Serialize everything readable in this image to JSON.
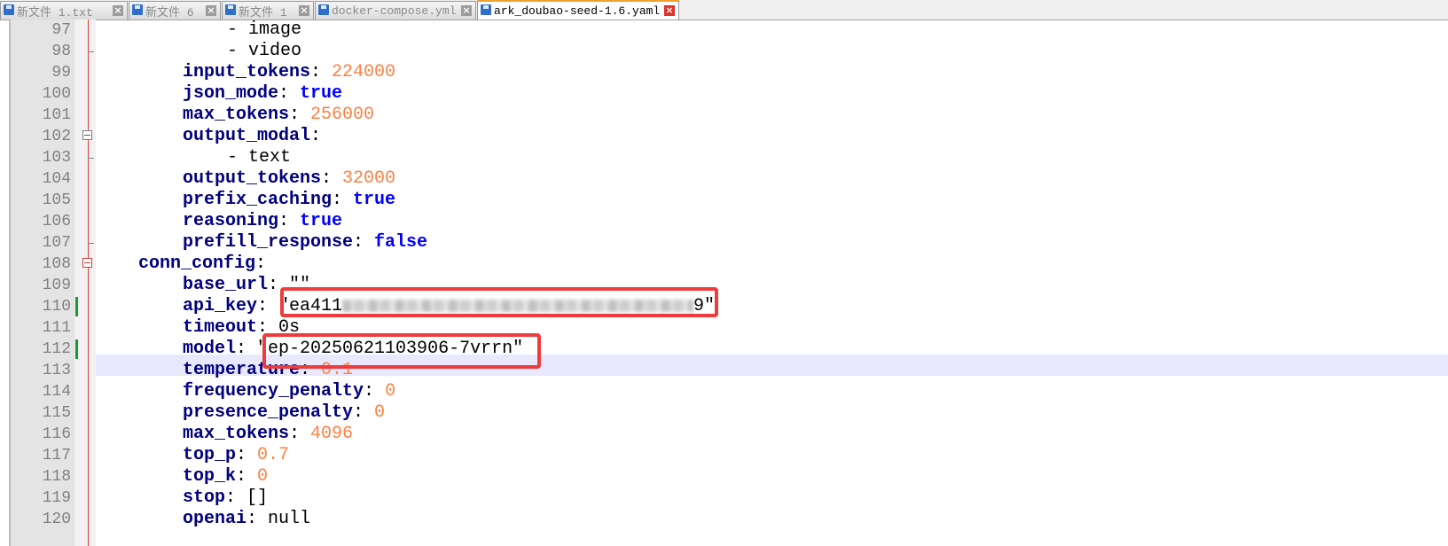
{
  "tabs": [
    {
      "label": "新文件 1.txt",
      "active": false
    },
    {
      "label": "新文件 6",
      "active": false
    },
    {
      "label": "新文件 1",
      "active": false
    },
    {
      "label": "docker-compose.yml",
      "active": false
    },
    {
      "label": "ark_doubao-seed-1.6.yaml",
      "active": true
    }
  ],
  "lines": [
    {
      "num": "97",
      "indent": "        ",
      "prefix": "- ",
      "key": "",
      "sep": "",
      "value": "image",
      "vtype": "plain"
    },
    {
      "num": "98",
      "indent": "        ",
      "prefix": "- ",
      "key": "",
      "sep": "",
      "value": "video",
      "vtype": "plain"
    },
    {
      "num": "99",
      "indent": "    ",
      "prefix": "",
      "key": "input_tokens",
      "sep": ": ",
      "value": "224000",
      "vtype": "num"
    },
    {
      "num": "100",
      "indent": "    ",
      "prefix": "",
      "key": "json_mode",
      "sep": ": ",
      "value": "true",
      "vtype": "bool"
    },
    {
      "num": "101",
      "indent": "    ",
      "prefix": "",
      "key": "max_tokens",
      "sep": ": ",
      "value": "256000",
      "vtype": "num"
    },
    {
      "num": "102",
      "indent": "    ",
      "prefix": "",
      "key": "output_modal",
      "sep": ":",
      "value": "",
      "vtype": "plain"
    },
    {
      "num": "103",
      "indent": "        ",
      "prefix": "- ",
      "key": "",
      "sep": "",
      "value": "text",
      "vtype": "plain"
    },
    {
      "num": "104",
      "indent": "    ",
      "prefix": "",
      "key": "output_tokens",
      "sep": ": ",
      "value": "32000",
      "vtype": "num"
    },
    {
      "num": "105",
      "indent": "    ",
      "prefix": "",
      "key": "prefix_caching",
      "sep": ": ",
      "value": "true",
      "vtype": "bool"
    },
    {
      "num": "106",
      "indent": "    ",
      "prefix": "",
      "key": "reasoning",
      "sep": ": ",
      "value": "true",
      "vtype": "bool"
    },
    {
      "num": "107",
      "indent": "    ",
      "prefix": "",
      "key": "prefill_response",
      "sep": ": ",
      "value": "false",
      "vtype": "bool"
    },
    {
      "num": "108",
      "indent": "",
      "prefix": "",
      "key": "conn_config",
      "sep": ":",
      "value": "",
      "vtype": "plain"
    },
    {
      "num": "109",
      "indent": "    ",
      "prefix": "",
      "key": "base_url",
      "sep": ": ",
      "value": "\"\"",
      "vtype": "str"
    },
    {
      "num": "110",
      "indent": "    ",
      "prefix": "",
      "key": "api_key",
      "sep": ": ",
      "value": "\"ea411",
      "value_tail": "9\"",
      "vtype": "secret"
    },
    {
      "num": "111",
      "indent": "    ",
      "prefix": "",
      "key": "timeout",
      "sep": ": ",
      "value": "0s",
      "vtype": "plain"
    },
    {
      "num": "112",
      "indent": "    ",
      "prefix": "",
      "key": "model",
      "sep": ": ",
      "value": "\"ep-20250621103906-7vrrn\"",
      "vtype": "str"
    },
    {
      "num": "113",
      "indent": "    ",
      "prefix": "",
      "key": "temperature",
      "sep": ": ",
      "value": "0.1",
      "vtype": "num"
    },
    {
      "num": "114",
      "indent": "    ",
      "prefix": "",
      "key": "frequency_penalty",
      "sep": ": ",
      "value": "0",
      "vtype": "num"
    },
    {
      "num": "115",
      "indent": "    ",
      "prefix": "",
      "key": "presence_penalty",
      "sep": ": ",
      "value": "0",
      "vtype": "num"
    },
    {
      "num": "116",
      "indent": "    ",
      "prefix": "",
      "key": "max_tokens",
      "sep": ": ",
      "value": "4096",
      "vtype": "num"
    },
    {
      "num": "117",
      "indent": "    ",
      "prefix": "",
      "key": "top_p",
      "sep": ": ",
      "value": "0.7",
      "vtype": "num"
    },
    {
      "num": "118",
      "indent": "    ",
      "prefix": "",
      "key": "top_k",
      "sep": ": ",
      "value": "0",
      "vtype": "num"
    },
    {
      "num": "119",
      "indent": "    ",
      "prefix": "",
      "key": "stop",
      "sep": ": ",
      "value": "[]",
      "vtype": "plain"
    },
    {
      "num": "120",
      "indent": "    ",
      "prefix": "",
      "key": "openai",
      "sep": ": ",
      "value": "null",
      "vtype": "plain"
    }
  ],
  "current_line": "112",
  "changed_lines": [
    "110",
    "112"
  ],
  "fold_open_lines": [
    "102",
    "108"
  ],
  "colors": {
    "key": "#000080",
    "number": "#ff8040",
    "boolean": "#0000ff",
    "current_line_bg": "#e8e8ff",
    "annotation": "#ee3b3b",
    "change_marker": "#1a9a2a"
  },
  "icons": {
    "tab_file": "save-disk-icon",
    "tab_close": "close-icon",
    "fold": "fold-minus-icon"
  }
}
